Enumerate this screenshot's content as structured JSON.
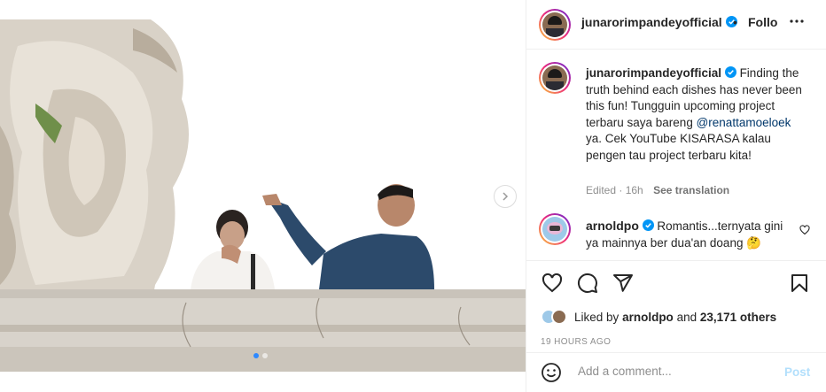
{
  "post": {
    "author": "junarorimpandeyofficial",
    "follow_label": "Follo",
    "separator": "•",
    "caption_text": "Finding the truth behind each dishes has never been this fun! Tungguin upcoming project terbaru saya bareng",
    "caption_mention": "@renattamoeloek",
    "caption_text_end": "ya. Cek YouTube KISARASA kalau pengen tau project terbaru kita!",
    "edited_label": "Edited",
    "age": "16h",
    "see_translation": "See translation"
  },
  "comment": {
    "author": "arnoldpo",
    "text": "Romantis...ternyata gini ya mainnya ber dua'an doang",
    "emoji": "🤔"
  },
  "likes": {
    "prefix": "Liked by",
    "user": "arnoldpo",
    "conjunction": "and",
    "count": "23,171 others"
  },
  "timestamp": "19 HOURS AGO",
  "add_comment": {
    "placeholder": "Add a comment...",
    "post_label": "Post"
  },
  "carousel": {
    "total": 2,
    "current": 1
  },
  "colors": {
    "verified": "#0095f6",
    "link": "#00376b",
    "post_disabled": "#b2dffc",
    "carousel_dot_active": "#2e89ff"
  },
  "icons": [
    "more-options-icon",
    "heart-icon",
    "comment-icon",
    "share-icon",
    "save-icon",
    "emoji-icon",
    "chevron-right-icon",
    "verified-icon"
  ]
}
